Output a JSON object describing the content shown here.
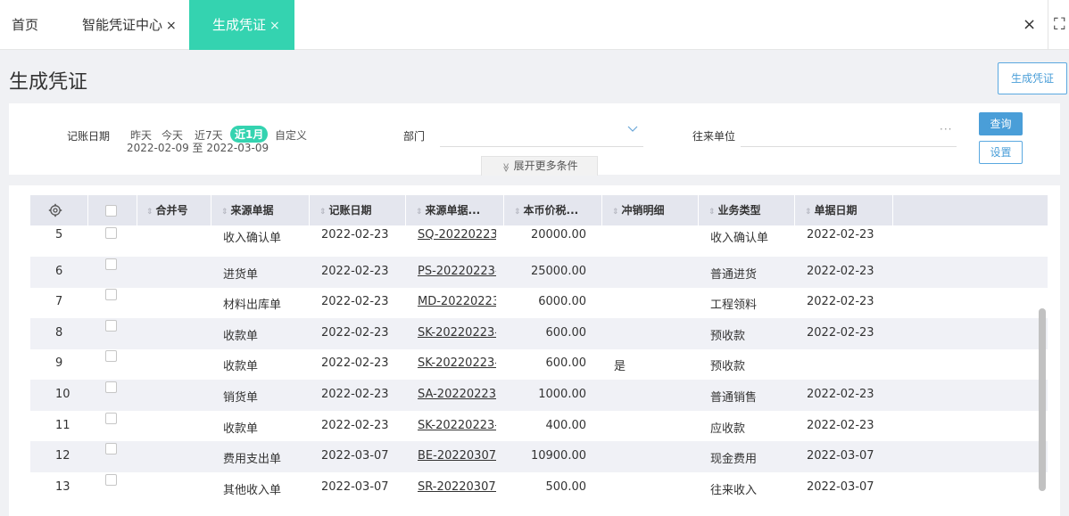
{
  "tabs": {
    "home": "首页",
    "voucher_center": "智能凭证中心",
    "generate_voucher": "生成凭证",
    "close": "×"
  },
  "window": {
    "close_all": "×",
    "fullscreen": "⛶"
  },
  "page": {
    "title": "生成凭证",
    "generate_button": "生成凭证"
  },
  "filters": {
    "date_label": "记账日期",
    "quick_dates": {
      "yesterday": "昨天",
      "today": "今天",
      "last7": "近7天",
      "last_month": "近1月",
      "custom": "自定义"
    },
    "date_range": "2022-02-09 至 2022-03-09",
    "department_label": "部门",
    "department_value": "",
    "partner_label": "往来单位",
    "partner_more": "···",
    "query_button": "查询",
    "settings_button": "设置",
    "expand_label": "展开更多条件",
    "expand_icon": "≫"
  },
  "table": {
    "columns": {
      "merge_no": "合并号",
      "source_doc": "来源单据",
      "post_date": "记账日期",
      "source_no": "来源单据...",
      "amount": "本币价税...",
      "writeoff": "冲销明细",
      "biz_type": "业务类型",
      "doc_date": "单据日期"
    },
    "rows": [
      {
        "idx": "5",
        "source_doc": "收入确认单",
        "post_date": "2022-02-23",
        "source_no": "SQ-20220223-(",
        "amount": "20000.00",
        "writeoff": "",
        "biz_type": "收入确认单",
        "doc_date": "2022-02-23"
      },
      {
        "idx": "6",
        "source_doc": "进货单",
        "post_date": "2022-02-23",
        "source_no": "PS-20220223-0",
        "amount": "25000.00",
        "writeoff": "",
        "biz_type": "普通进货",
        "doc_date": "2022-02-23"
      },
      {
        "idx": "7",
        "source_doc": "材料出库单",
        "post_date": "2022-02-23",
        "source_no": "MD-20220223-",
        "amount": "6000.00",
        "writeoff": "",
        "biz_type": "工程领料",
        "doc_date": "2022-02-23"
      },
      {
        "idx": "8",
        "source_doc": "收款单",
        "post_date": "2022-02-23",
        "source_no": "SK-20220223-(",
        "amount": "600.00",
        "writeoff": "",
        "biz_type": "预收款",
        "doc_date": "2022-02-23"
      },
      {
        "idx": "9",
        "source_doc": "收款单",
        "post_date": "2022-02-23",
        "source_no": "SK-20220223-(",
        "amount": "600.00",
        "writeoff": "是",
        "biz_type": "预收款",
        "doc_date": ""
      },
      {
        "idx": "10",
        "source_doc": "销货单",
        "post_date": "2022-02-23",
        "source_no": "SA-20220223-(",
        "amount": "1000.00",
        "writeoff": "",
        "biz_type": "普通销售",
        "doc_date": "2022-02-23"
      },
      {
        "idx": "11",
        "source_doc": "收款单",
        "post_date": "2022-02-23",
        "source_no": "SK-20220223-(",
        "amount": "400.00",
        "writeoff": "",
        "biz_type": "应收款",
        "doc_date": "2022-02-23"
      },
      {
        "idx": "12",
        "source_doc": "费用支出单",
        "post_date": "2022-03-07",
        "source_no": "BE-20220307-(",
        "amount": "10900.00",
        "writeoff": "",
        "biz_type": "现金费用",
        "doc_date": "2022-03-07"
      },
      {
        "idx": "13",
        "source_doc": "其他收入单",
        "post_date": "2022-03-07",
        "source_no": "SR-20220307-(",
        "amount": "500.00",
        "writeoff": "",
        "biz_type": "往来收入",
        "doc_date": "2022-03-07"
      }
    ]
  },
  "colors": {
    "accent": "#34d3b0",
    "primary": "#4a9ed8"
  },
  "icons": {
    "settings": "gear-icon",
    "sort": "sort-icon",
    "dropdown": "chevron-down-icon"
  }
}
